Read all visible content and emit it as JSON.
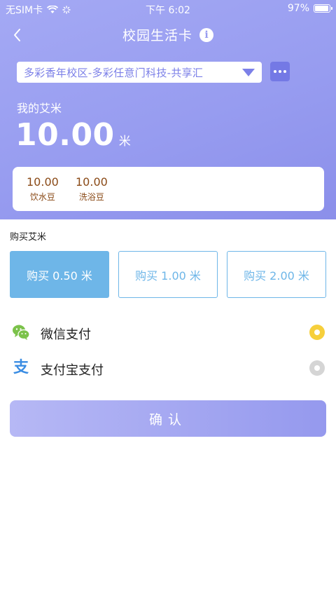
{
  "status_bar": {
    "carrier": "无SIM卡",
    "time": "下午 6:02",
    "battery_text": "97%",
    "battery_level": 0.97
  },
  "nav": {
    "back_icon": "chevron-left-icon",
    "title": "校园生活卡",
    "info_icon": "info-icon",
    "info_glyph": "i"
  },
  "campus": {
    "selected": "多彩香年校区-多彩任意门科技-共享汇",
    "dropdown_icon": "triangle-down-icon",
    "more_icon": "more-dots-icon"
  },
  "balance": {
    "label": "我的艾米",
    "value": "10.00",
    "unit": "米"
  },
  "beans": [
    {
      "value": "10.00",
      "label": "饮水豆"
    },
    {
      "value": "10.00",
      "label": "洗浴豆"
    }
  ],
  "buy": {
    "label": "购买艾米",
    "options": [
      {
        "label": "购买 0.50 米",
        "selected": true
      },
      {
        "label": "购买 1.00 米",
        "selected": false
      },
      {
        "label": "购买 2.00 米",
        "selected": false
      }
    ]
  },
  "payment": {
    "methods": [
      {
        "label": "微信支付",
        "icon": "wechat-pay-icon",
        "selected": true
      },
      {
        "label": "支付宝支付",
        "icon": "alipay-icon",
        "icon_glyph": "支",
        "selected": false
      }
    ]
  },
  "confirm_label": "确认",
  "colors": {
    "header_gradient_start": "#a4a9f4",
    "header_gradient_end": "#8b8fea",
    "accent_blue": "#6eb6e8",
    "purple": "#7c80e8",
    "radio_on": "#f6cf3c",
    "bean_text": "#8a4a17",
    "wechat_green": "#7bc24a",
    "alipay_blue": "#3b8de3"
  }
}
